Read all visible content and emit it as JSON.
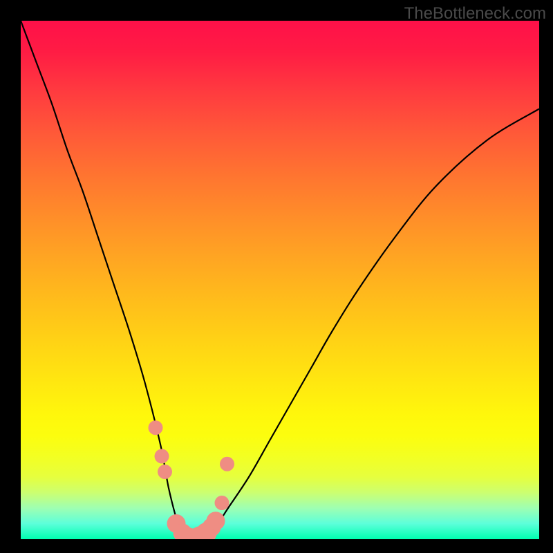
{
  "watermark": "TheBottleneck.com",
  "chart_data": {
    "type": "line",
    "title": "",
    "xlabel": "",
    "ylabel": "",
    "xlim": [
      0,
      100
    ],
    "ylim": [
      0,
      100
    ],
    "grid": false,
    "series": [
      {
        "name": "bottleneck-curve",
        "x": [
          0,
          3,
          6,
          9,
          12,
          15,
          18,
          21,
          24,
          27,
          28.5,
          30,
          31,
          32,
          33,
          34,
          36,
          38,
          40,
          44,
          48,
          52,
          56,
          60,
          65,
          72,
          80,
          90,
          100
        ],
        "values": [
          100,
          92,
          84,
          75,
          67,
          58,
          49,
          40,
          30,
          18,
          10,
          4,
          1,
          0,
          0,
          0,
          1,
          3,
          6,
          12,
          19,
          26,
          33,
          40,
          48,
          58,
          68,
          77,
          83
        ]
      }
    ],
    "markers": [
      {
        "name": "dot",
        "x": 26.0,
        "y": 21.5,
        "r": 1.4
      },
      {
        "name": "dot",
        "x": 27.2,
        "y": 16.0,
        "r": 1.4
      },
      {
        "name": "dot",
        "x": 27.8,
        "y": 13.0,
        "r": 1.4
      },
      {
        "name": "dot",
        "x": 30.0,
        "y": 3.0,
        "r": 1.8
      },
      {
        "name": "dot",
        "x": 31.2,
        "y": 1.2,
        "r": 1.8
      },
      {
        "name": "dot",
        "x": 32.2,
        "y": 0.5,
        "r": 1.8
      },
      {
        "name": "dot",
        "x": 33.4,
        "y": 0.3,
        "r": 1.8
      },
      {
        "name": "dot",
        "x": 34.6,
        "y": 0.5,
        "r": 2.0
      },
      {
        "name": "dot",
        "x": 35.8,
        "y": 1.2,
        "r": 2.0
      },
      {
        "name": "dot",
        "x": 36.8,
        "y": 2.3,
        "r": 1.8
      },
      {
        "name": "dot",
        "x": 37.6,
        "y": 3.5,
        "r": 1.8
      },
      {
        "name": "dot",
        "x": 38.8,
        "y": 7.0,
        "r": 1.4
      },
      {
        "name": "dot",
        "x": 39.8,
        "y": 14.5,
        "r": 1.4
      }
    ],
    "marker_color": "#ef8d83",
    "curve_color": "#000000",
    "curve_width": 2.2
  }
}
